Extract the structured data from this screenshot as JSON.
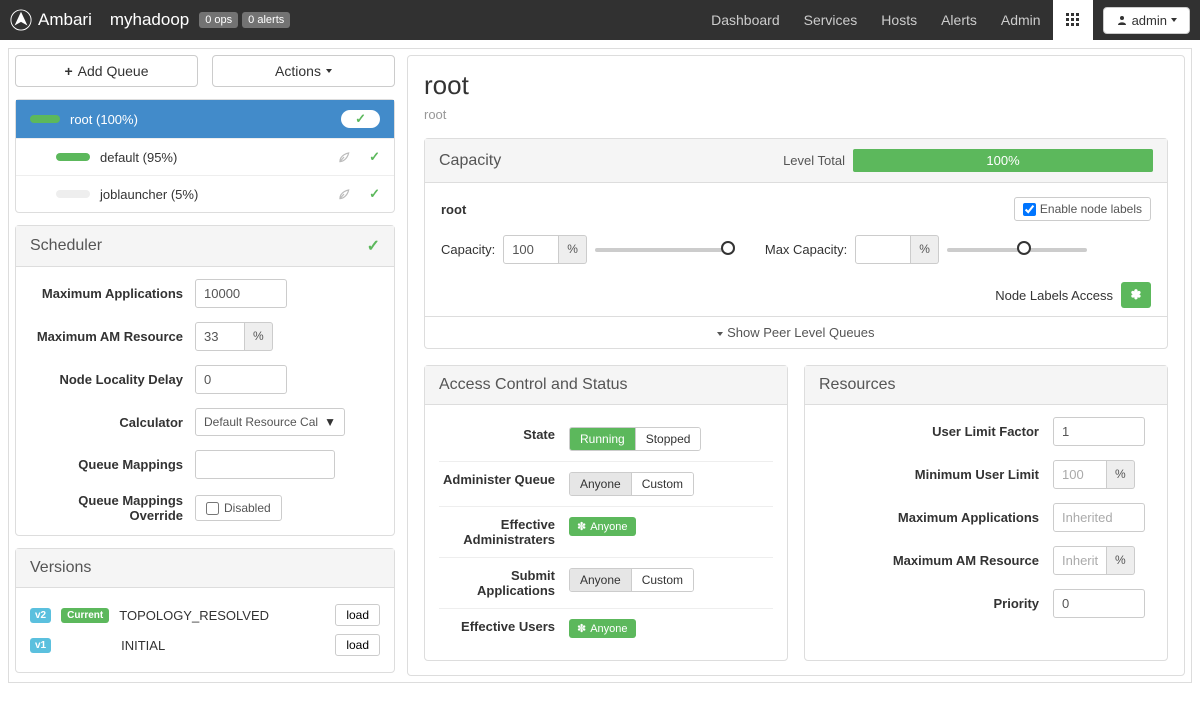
{
  "topnav": {
    "brand": "Ambari",
    "cluster": "myhadoop",
    "ops_badge": "0 ops",
    "alerts_badge": "0 alerts",
    "links": [
      "Dashboard",
      "Services",
      "Hosts",
      "Alerts",
      "Admin"
    ],
    "admin_button": "admin"
  },
  "sidebar": {
    "add_queue": "Add Queue",
    "actions": "Actions",
    "tree": {
      "root": "root (100%)",
      "default": "default (95%)",
      "joblauncher": "joblauncher (5%)"
    },
    "scheduler": {
      "title": "Scheduler",
      "max_apps_label": "Maximum Applications",
      "max_apps_value": "10000",
      "max_am_label": "Maximum AM Resource",
      "max_am_value": "33",
      "locality_label": "Node Locality Delay",
      "locality_value": "0",
      "calculator_label": "Calculator",
      "calculator_value": "Default Resource Cal",
      "mappings_label": "Queue Mappings",
      "override_label": "Queue Mappings Override",
      "override_value": "Disabled"
    },
    "versions": {
      "title": "Versions",
      "v2_tag": "v2",
      "current": "Current",
      "v2_state": "TOPOLOGY_RESOLVED",
      "v1_tag": "v1",
      "v1_state": "INITIAL",
      "load": "load"
    }
  },
  "main": {
    "title": "root",
    "crumb": "root",
    "capacity": {
      "title": "Capacity",
      "level_total": "Level Total",
      "level_pct": "100%",
      "root_label": "root",
      "enable_labels": "Enable node labels",
      "capacity_label": "Capacity:",
      "capacity_value": "100",
      "max_capacity_label": "Max Capacity:",
      "max_capacity_value": "",
      "node_labels": "Node Labels Access",
      "show_peer": "Show Peer Level Queues"
    },
    "acs": {
      "title": "Access Control and Status",
      "state_label": "State",
      "running": "Running",
      "stopped": "Stopped",
      "admin_label": "Administer Queue",
      "anyone": "Anyone",
      "custom": "Custom",
      "eff_admin_label": "Effective Administraters",
      "submit_label": "Submit Applications",
      "eff_users_label": "Effective Users",
      "anyone_tag": "Anyone"
    },
    "resources": {
      "title": "Resources",
      "ulf_label": "User Limit Factor",
      "ulf_value": "1",
      "mul_label": "Minimum User Limit",
      "mul_placeholder": "100",
      "ma_label": "Maximum Applications",
      "ma_placeholder": "Inherited",
      "mam_label": "Maximum AM Resource",
      "mam_placeholder": "Inherited",
      "priority_label": "Priority",
      "priority_value": "0",
      "pct": "%"
    }
  }
}
